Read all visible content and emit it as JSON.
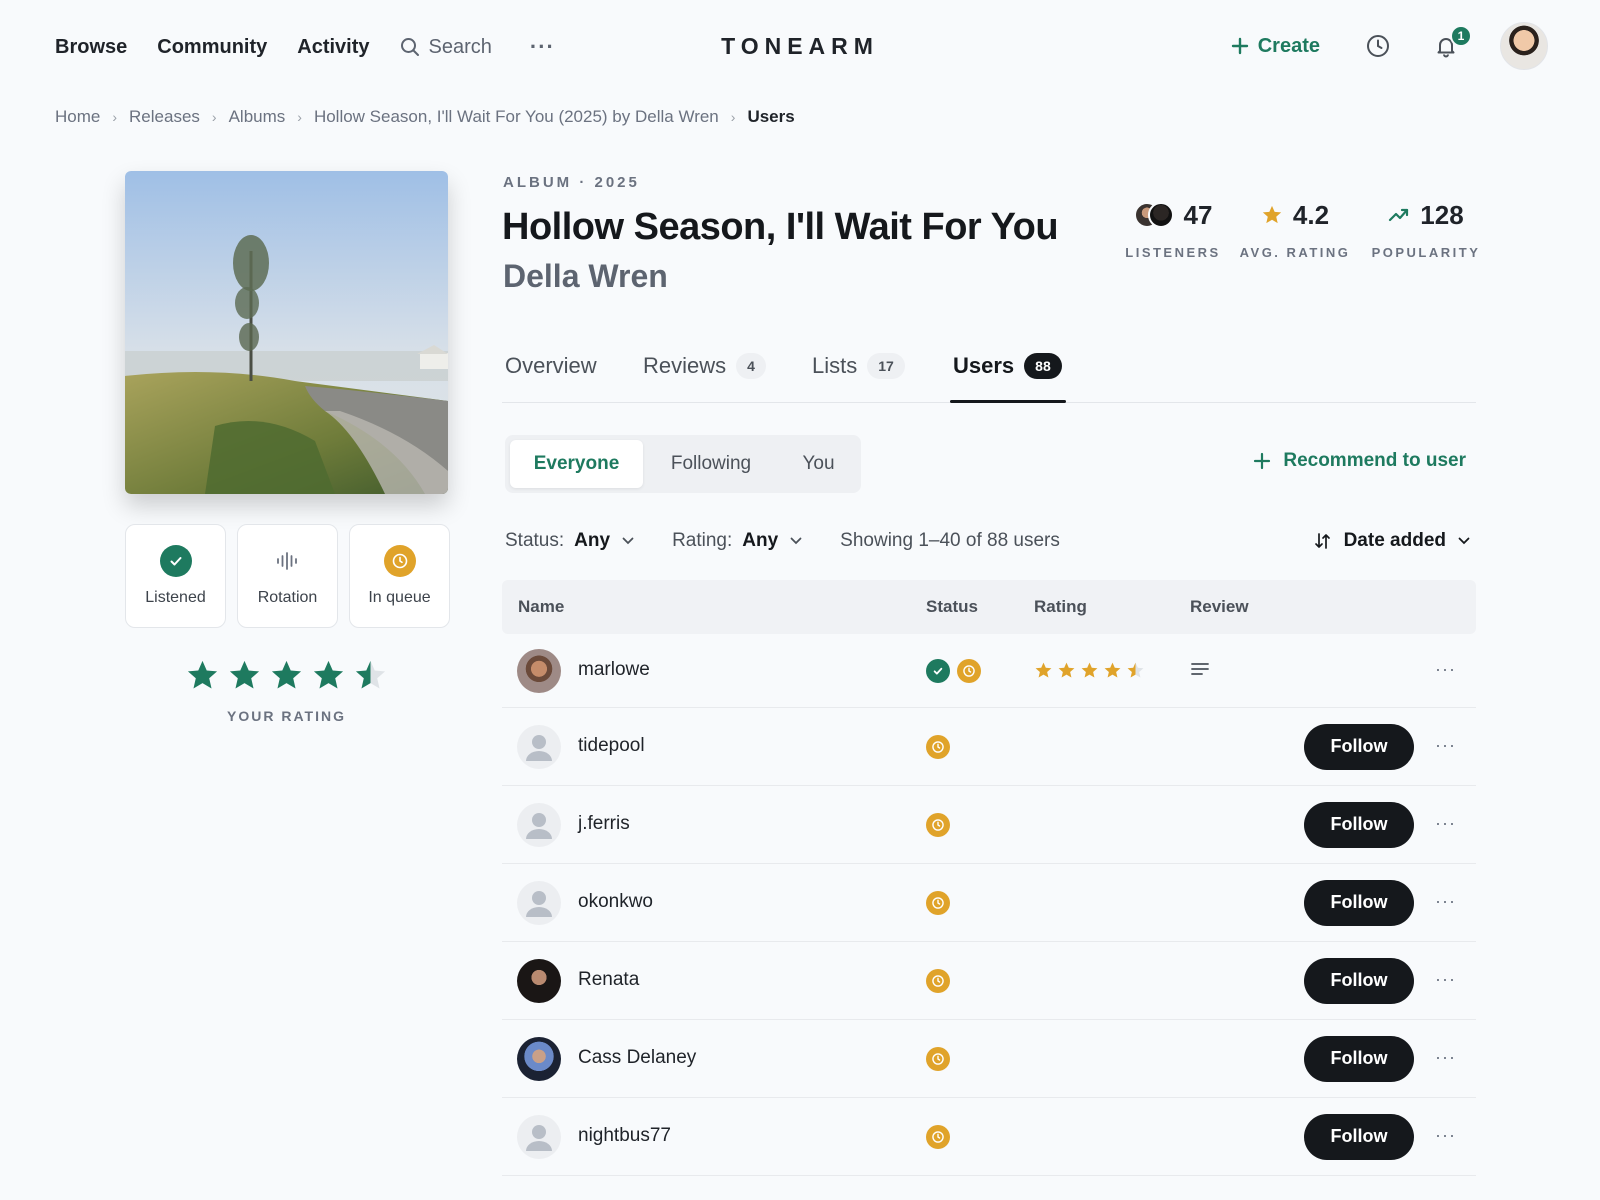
{
  "nav": {
    "browse": "Browse",
    "community": "Community",
    "activity": "Activity",
    "search": "Search",
    "more": "···",
    "brand": "TONEARM",
    "create": "Create",
    "notifications_count": "1"
  },
  "breadcrumb": [
    "Home",
    "Releases",
    "Albums",
    "Hollow Season, I'll Wait For You (2025) by Della Wren",
    "Users"
  ],
  "album": {
    "meta": "ALBUM · 2025",
    "title": "Hollow Season, I'll Wait For You",
    "artist": "Della Wren"
  },
  "stats": {
    "listeners_value": "47",
    "listeners_label": "LISTENERS",
    "rating_value": "4.2",
    "rating_label": "AVG. RATING",
    "popularity_value": "128",
    "popularity_label": "POPULARITY"
  },
  "actions": {
    "listened": "Listened",
    "rotation": "Rotation",
    "queue": "In queue"
  },
  "your_rating": {
    "label": "YOUR RATING",
    "value": 4.5,
    "max": 5
  },
  "tabs": [
    {
      "label": "Overview",
      "count": ""
    },
    {
      "label": "Reviews",
      "count": "4"
    },
    {
      "label": "Lists",
      "count": "17"
    },
    {
      "label": "Users",
      "count": "88"
    }
  ],
  "segments": [
    "Everyone",
    "Following",
    "You"
  ],
  "recommend": "Recommend to user",
  "filters": {
    "status_label": "Status:",
    "status_value": "Any",
    "rating_label": "Rating:",
    "rating_value": "Any",
    "showing": "Showing 1–40 of 88 users",
    "sort": "Date added"
  },
  "table": {
    "headers": {
      "name": "Name",
      "status": "Status",
      "rating": "Rating",
      "review": "Review"
    },
    "follow_label": "Follow",
    "more": "···",
    "rows": [
      {
        "name": "marlowe",
        "listened": true,
        "queued": true,
        "rating": 4.5,
        "review": true,
        "follow": false
      },
      {
        "name": "tidepool",
        "listened": false,
        "queued": true,
        "rating": null,
        "review": false,
        "follow": true
      },
      {
        "name": "j.ferris",
        "listened": false,
        "queued": true,
        "rating": null,
        "review": false,
        "follow": true
      },
      {
        "name": "okonkwo",
        "listened": false,
        "queued": true,
        "rating": null,
        "review": false,
        "follow": true
      },
      {
        "name": "Renata",
        "listened": false,
        "queued": true,
        "rating": null,
        "review": false,
        "follow": true
      },
      {
        "name": "Cass Delaney",
        "listened": false,
        "queued": true,
        "rating": null,
        "review": false,
        "follow": true
      },
      {
        "name": "nightbus77",
        "listened": false,
        "queued": true,
        "rating": null,
        "review": false,
        "follow": true
      }
    ]
  },
  "colors": {
    "accent": "#1e7a5f",
    "amber": "#e0a32a",
    "dark": "#15181c"
  }
}
